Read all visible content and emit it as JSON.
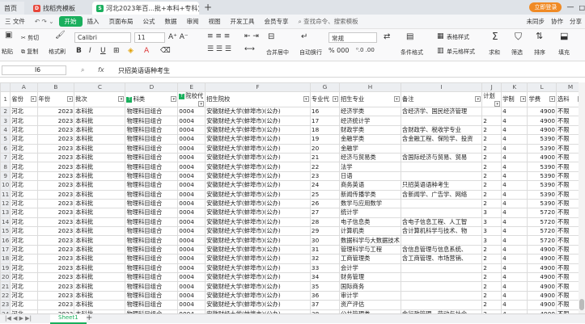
{
  "tabs": {
    "home": "首页",
    "tab1": "找稻壳模板",
    "tab2": "河北2023年百...批+本科+专科)"
  },
  "login": "立即登录",
  "menus": [
    "三 文件",
    "开始",
    "插入",
    "页面布局",
    "公式",
    "数据",
    "审阅",
    "视图",
    "开发工具",
    "会员专享"
  ],
  "menu_search": "查找命令、搜索模板",
  "menu_right": [
    "未同步",
    "协作",
    "分享"
  ],
  "toolbar": {
    "cut": "剪切",
    "copy": "复制",
    "format_painter": "格式刷",
    "paste": "粘贴",
    "font": "Calibri",
    "size": "11",
    "merge": "合并居中",
    "wrap": "自动换行",
    "numfmt": "常规",
    "cond": "条件格式",
    "table_style": "表格样式",
    "cell_style": "单元格样式",
    "filter": "筛选",
    "sort": "排序",
    "sum": "求和",
    "fill": "填充",
    "sumsign": "Σ",
    "pct": "% 000",
    "dec": "⁰.0 .00"
  },
  "formula": {
    "cellref": "I6",
    "fx": "fx",
    "content": "只招英语语种考生"
  },
  "columns": [
    "A",
    "B",
    "C",
    "D",
    "E",
    "F",
    "G",
    "H",
    "I",
    "J",
    "K",
    "L",
    "M"
  ],
  "header_row": {
    "num": "1",
    "cells": [
      "省份",
      "年份",
      "批次",
      "科类",
      "院校代",
      "招生院校",
      "专业代",
      "招生专业",
      "备注",
      "计划",
      "学制",
      "学费",
      "选科"
    ]
  },
  "rows": [
    {
      "num": "2",
      "cells": [
        "河北",
        "2023",
        "本科批",
        "物理科目组合",
        "0004",
        "安徽财经大学(蚌埠市)(公办)",
        "16",
        "经济学类",
        "含经济学、国民经济管理",
        "",
        "4",
        "4900",
        "不限"
      ]
    },
    {
      "num": "3",
      "cells": [
        "河北",
        "2023",
        "本科批",
        "物理科目组合",
        "0004",
        "安徽财经大学(蚌埠市)(公办)",
        "17",
        "经济统计学",
        "",
        "2",
        "4",
        "4900",
        "不限"
      ]
    },
    {
      "num": "4",
      "cells": [
        "河北",
        "2023",
        "本科批",
        "物理科目组合",
        "0004",
        "安徽财经大学(蚌埠市)(公办)",
        "18",
        "财政学类",
        "含财政学、税收学专业",
        "2",
        "4",
        "4900",
        "不限"
      ]
    },
    {
      "num": "5",
      "cells": [
        "河北",
        "2023",
        "本科批",
        "物理科目组合",
        "0004",
        "安徽财经大学(蚌埠市)(公办)",
        "19",
        "金融学类",
        "含金融工程、保险学、投资",
        "2",
        "4",
        "5390",
        "不限"
      ]
    },
    {
      "num": "6",
      "cells": [
        "河北",
        "2023",
        "本科批",
        "物理科目组合",
        "0004",
        "安徽财经大学(蚌埠市)(公办)",
        "20",
        "金融学",
        "",
        "2",
        "4",
        "5390",
        "不限"
      ]
    },
    {
      "num": "7",
      "cells": [
        "河北",
        "2023",
        "本科批",
        "物理科目组合",
        "0004",
        "安徽财经大学(蚌埠市)(公办)",
        "21",
        "经济与贸易类",
        "含国际经济与贸易、贸易",
        "2",
        "4",
        "4900",
        "不限"
      ]
    },
    {
      "num": "8",
      "cells": [
        "河北",
        "2023",
        "本科批",
        "物理科目组合",
        "0004",
        "安徽财经大学(蚌埠市)(公办)",
        "22",
        "法学",
        "",
        "2",
        "4",
        "5390",
        "不限"
      ]
    },
    {
      "num": "9",
      "cells": [
        "河北",
        "2023",
        "本科批",
        "物理科目组合",
        "0004",
        "安徽财经大学(蚌埠市)(公办)",
        "23",
        "日语",
        "",
        "2",
        "4",
        "5390",
        "不限"
      ]
    },
    {
      "num": "10",
      "cells": [
        "河北",
        "2023",
        "本科批",
        "物理科目组合",
        "0004",
        "安徽财经大学(蚌埠市)(公办)",
        "24",
        "商务英语",
        "只招英语语种考生",
        "2",
        "4",
        "5390",
        "不限"
      ]
    },
    {
      "num": "11",
      "cells": [
        "河北",
        "2023",
        "本科批",
        "物理科目组合",
        "0004",
        "安徽财经大学(蚌埠市)(公办)",
        "25",
        "新闻传播学类",
        "含新闻学、广告学、网络",
        "2",
        "4",
        "5390",
        "不限"
      ]
    },
    {
      "num": "12",
      "cells": [
        "河北",
        "2023",
        "本科批",
        "物理科目组合",
        "0004",
        "安徽财经大学(蚌埠市)(公办)",
        "26",
        "数学与应用数学",
        "",
        "2",
        "4",
        "5390",
        "不限"
      ]
    },
    {
      "num": "13",
      "cells": [
        "河北",
        "2023",
        "本科批",
        "物理科目组合",
        "0004",
        "安徽财经大学(蚌埠市)(公办)",
        "27",
        "统计学",
        "",
        "3",
        "4",
        "5720",
        "不限"
      ]
    },
    {
      "num": "14",
      "cells": [
        "河北",
        "2023",
        "本科批",
        "物理科目组合",
        "0004",
        "安徽财经大学(蚌埠市)(公办)",
        "28",
        "电子信息类",
        "含电子信息工程、人工智",
        "3",
        "4",
        "5720",
        "不限"
      ]
    },
    {
      "num": "15",
      "cells": [
        "河北",
        "2023",
        "本科批",
        "物理科目组合",
        "0004",
        "安徽财经大学(蚌埠市)(公办)",
        "29",
        "计算机类",
        "含计算机科学与技术、物",
        "3",
        "4",
        "5720",
        "不限"
      ]
    },
    {
      "num": "16",
      "cells": [
        "河北",
        "2023",
        "本科批",
        "物理科目组合",
        "0004",
        "安徽财经大学(蚌埠市)(公办)",
        "30",
        "数据科学与大数据技术",
        "",
        "3",
        "4",
        "5720",
        "不限"
      ]
    },
    {
      "num": "17",
      "cells": [
        "河北",
        "2023",
        "本科批",
        "物理科目组合",
        "0004",
        "安徽财经大学(蚌埠市)(公办)",
        "31",
        "管理科学与工程",
        "含信息管理与信息系统、",
        "2",
        "4",
        "4900",
        "不限"
      ]
    },
    {
      "num": "18",
      "cells": [
        "河北",
        "2023",
        "本科批",
        "物理科目组合",
        "0004",
        "安徽财经大学(蚌埠市)(公办)",
        "32",
        "工商管理类",
        "含工商管理、市场营销、",
        "2",
        "4",
        "4900",
        "不限"
      ]
    },
    {
      "num": "19",
      "cells": [
        "河北",
        "2023",
        "本科批",
        "物理科目组合",
        "0004",
        "安徽财经大学(蚌埠市)(公办)",
        "33",
        "会计学",
        "",
        "2",
        "4",
        "4900",
        "不限"
      ]
    },
    {
      "num": "20",
      "cells": [
        "河北",
        "2023",
        "本科批",
        "物理科目组合",
        "0004",
        "安徽财经大学(蚌埠市)(公办)",
        "34",
        "财务管理",
        "",
        "2",
        "4",
        "4900",
        "不限"
      ]
    },
    {
      "num": "21",
      "cells": [
        "河北",
        "2023",
        "本科批",
        "物理科目组合",
        "0004",
        "安徽财经大学(蚌埠市)(公办)",
        "35",
        "国际商务",
        "",
        "2",
        "4",
        "4900",
        "不限"
      ]
    },
    {
      "num": "22",
      "cells": [
        "河北",
        "2023",
        "本科批",
        "物理科目组合",
        "0004",
        "安徽财经大学(蚌埠市)(公办)",
        "36",
        "审计学",
        "",
        "2",
        "4",
        "4900",
        "不限"
      ]
    },
    {
      "num": "23",
      "cells": [
        "河北",
        "2023",
        "本科批",
        "物理科目组合",
        "0004",
        "安徽财经大学(蚌埠市)(公办)",
        "37",
        "资产评估",
        "",
        "2",
        "4",
        "4900",
        "不限"
      ]
    },
    {
      "num": "24",
      "cells": [
        "河北",
        "2023",
        "本科批",
        "物理科目组合",
        "0004",
        "安徽财经大学(蚌埠市)(公办)",
        "38",
        "公共管理类",
        "含行政管理、劳动与社会",
        "2",
        "4",
        "4900",
        "不限"
      ]
    }
  ],
  "sheet_tab": "Sheet1"
}
